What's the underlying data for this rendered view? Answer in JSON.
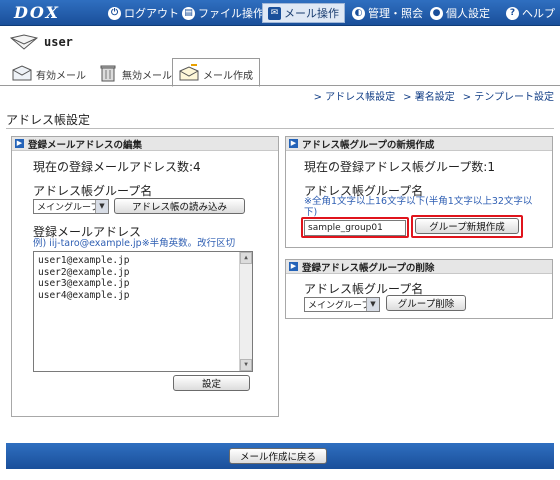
{
  "brand": {
    "logo": "DOX"
  },
  "nav": [
    {
      "label": "ログアウト",
      "icon": "power-icon"
    },
    {
      "label": "ファイル操作",
      "icon": "file-icon"
    },
    {
      "label": "メール操作",
      "icon": "mail-icon",
      "active": true
    },
    {
      "label": "管理・照会",
      "icon": "admin-icon"
    },
    {
      "label": "個人設定",
      "icon": "person-icon"
    },
    {
      "label": "ヘルプ",
      "icon": "help-icon"
    }
  ],
  "user": {
    "name": "user"
  },
  "tabs": [
    {
      "label": "有効メール",
      "icon": "envelope-icon"
    },
    {
      "label": "無効メール",
      "icon": "trash-icon"
    },
    {
      "label": "メール作成",
      "icon": "compose-icon",
      "active": true
    }
  ],
  "sublinks": [
    "アドレス帳設定",
    "署名設定",
    "テンプレート設定"
  ],
  "page_title": "アドレス帳設定",
  "edit_panel": {
    "header": "登録メールアドレスの編集",
    "count_text": "現在の登録メールアドレス数:4",
    "group_label": "アドレス帳グループ名",
    "group_selected": "メイングループ",
    "load_button": "アドレス帳の読み込み",
    "addresses_label": "登録メールアドレス",
    "addresses_hint": "例) iij-taro@example.jp※半角英数。改行区切",
    "addresses": [
      "user1@example.jp",
      "user2@example.jp",
      "user3@example.jp",
      "user4@example.jp"
    ],
    "save_button": "設定"
  },
  "create_panel": {
    "header": "アドレス帳グループの新規作成",
    "count_text": "現在の登録アドレス帳グループ数:1",
    "group_label": "アドレス帳グループ名",
    "hint": "※全角1文字以上16文字以下(半角1文字以上32文字以下)",
    "input_value": "sample_group01",
    "create_button": "グループ新規作成"
  },
  "delete_panel": {
    "header": "登録アドレス帳グループの削除",
    "group_label": "アドレス帳グループ名",
    "group_selected": "メイングループ",
    "delete_button": "グループ削除"
  },
  "footer": {
    "back_button": "メール作成に戻る"
  },
  "colors": {
    "accent": "#1a4f9a",
    "highlight": "#e0141c",
    "hint": "#2f5fb3"
  }
}
